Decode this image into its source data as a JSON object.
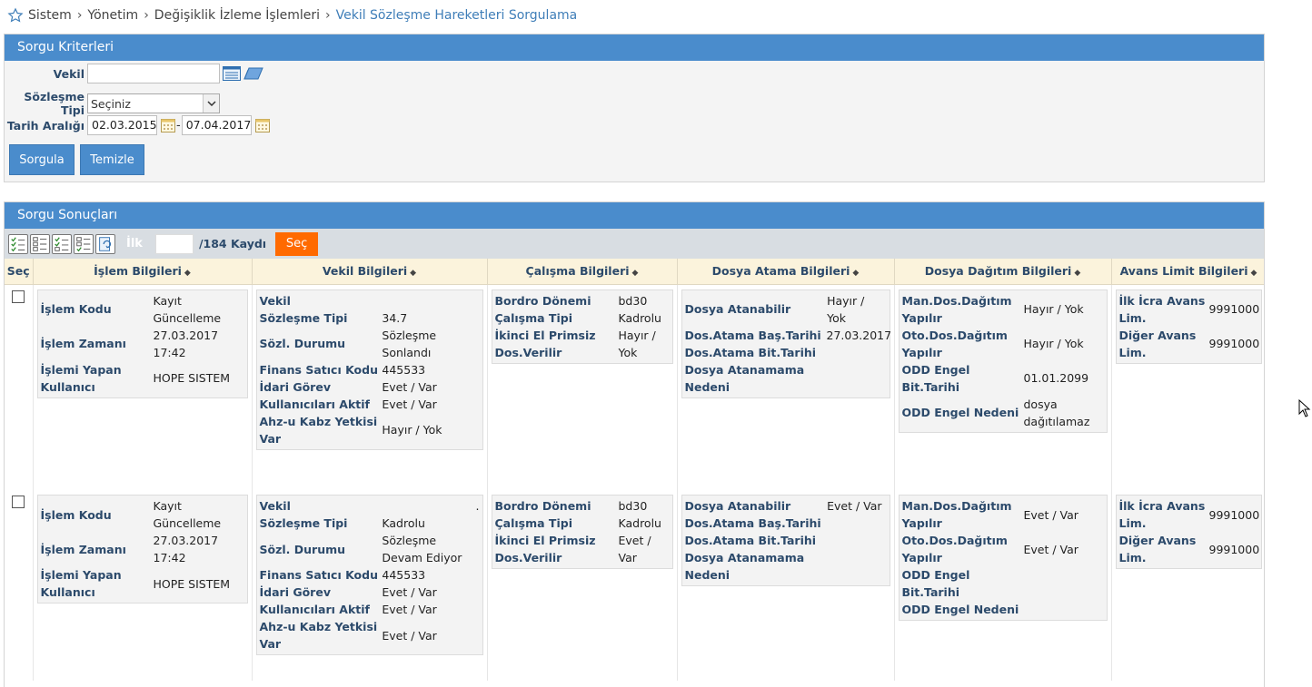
{
  "breadcrumb": [
    "Sistem",
    "Yönetim",
    "Değişiklik İzleme İşlemleri",
    "Vekil Sözleşme Hareketleri Sorgulama"
  ],
  "criteria": {
    "title": "Sorgu Kriterleri",
    "vekil_label": "Vekil",
    "vekil_value": "",
    "sozlesme_label": "Sözleşme Tipi",
    "sozlesme_value": "Seçiniz",
    "tarih_label": "Tarih Aralığı",
    "tarih_start": "02.03.2015",
    "tarih_dash": "-",
    "tarih_end": "07.04.2017",
    "sorgula": "Sorgula",
    "temizle": "Temizle"
  },
  "results": {
    "title": "Sorgu Sonuçları",
    "ilk_label": "İlk",
    "ilk_value": "",
    "count_label": "/184 Kaydı",
    "sec_button": "Seç",
    "headers": [
      "Seç",
      "İşlem Bilgileri",
      "Vekil Bilgileri",
      "Çalışma Bilgileri",
      "Dosya Atama Bilgileri",
      "Dosya Dağıtım Bilgileri",
      "Avans Limit Bilgileri"
    ],
    "rows": [
      {
        "islem": [
          {
            "k": "İşlem Kodu",
            "v": "Kayıt Güncelleme"
          },
          {
            "k": "İşlem Zamanı",
            "v": "27.03.2017 17:42"
          },
          {
            "k": "İşlemi Yapan Kullanıcı",
            "v": "HOPE SISTEM"
          }
        ],
        "vekil": [
          {
            "k": "Vekil",
            "v": ""
          },
          {
            "k": "Sözleşme Tipi",
            "v": "34.7"
          },
          {
            "k": "Sözl. Durumu",
            "v": "Sözleşme Sonlandı"
          },
          {
            "k": "Finans Satıcı Kodu",
            "v": "445533"
          },
          {
            "k": "İdari Görev",
            "v": "Evet / Var"
          },
          {
            "k": "Kullanıcıları Aktif",
            "v": "Evet / Var"
          },
          {
            "k": "Ahz-u Kabz Yetkisi Var",
            "v": "Hayır / Yok"
          }
        ],
        "calisma": [
          {
            "k": "Bordro Dönemi",
            "v": "bd30"
          },
          {
            "k": "Çalışma Tipi",
            "v": "Kadrolu"
          },
          {
            "k": "İkinci El Primsiz Dos.Verilir",
            "v": "Hayır / Yok"
          }
        ],
        "atama": [
          {
            "k": "Dosya Atanabilir",
            "v": "Hayır / Yok"
          },
          {
            "k": "Dos.Atama Baş.Tarihi",
            "v": "27.03.2017"
          },
          {
            "k": "Dos.Atama Bit.Tarihi",
            "v": ""
          },
          {
            "k": "Dosya Atanamama Nedeni",
            "v": ""
          }
        ],
        "dagitim": [
          {
            "k": "Man.Dos.Dağıtım Yapılır",
            "v": "Hayır / Yok"
          },
          {
            "k": "Oto.Dos.Dağıtım Yapılır",
            "v": "Hayır / Yok"
          },
          {
            "k": "ODD Engel Bit.Tarihi",
            "v": "01.01.2099"
          },
          {
            "k": "ODD Engel Nedeni",
            "v": "dosya dağıtılamaz"
          }
        ],
        "avans": [
          {
            "k": "İlk İcra Avans Lim.",
            "v": "9991000"
          },
          {
            "k": "Diğer Avans Lim.",
            "v": "9991000"
          }
        ]
      },
      {
        "islem": [
          {
            "k": "İşlem Kodu",
            "v": "Kayıt Güncelleme"
          },
          {
            "k": "İşlem Zamanı",
            "v": "27.03.2017 17:42"
          },
          {
            "k": "İşlemi Yapan Kullanıcı",
            "v": "HOPE SISTEM"
          }
        ],
        "vekil": [
          {
            "k": "Vekil",
            "v": "."
          },
          {
            "k": "Sözleşme Tipi",
            "v": "Kadrolu"
          },
          {
            "k": "Sözl. Durumu",
            "v": "Sözleşme Devam Ediyor"
          },
          {
            "k": "Finans Satıcı Kodu",
            "v": "445533"
          },
          {
            "k": "İdari Görev",
            "v": "Evet / Var"
          },
          {
            "k": "Kullanıcıları Aktif",
            "v": "Evet / Var"
          },
          {
            "k": "Ahz-u Kabz Yetkisi Var",
            "v": "Evet / Var"
          }
        ],
        "calisma": [
          {
            "k": "Bordro Dönemi",
            "v": "bd30"
          },
          {
            "k": "Çalışma Tipi",
            "v": "Kadrolu"
          },
          {
            "k": "İkinci El Primsiz Dos.Verilir",
            "v": "Evet / Var"
          }
        ],
        "atama": [
          {
            "k": "Dosya Atanabilir",
            "v": "Evet / Var"
          },
          {
            "k": "Dos.Atama Baş.Tarihi",
            "v": ""
          },
          {
            "k": "Dos.Atama Bit.Tarihi",
            "v": ""
          },
          {
            "k": "Dosya Atanamama Nedeni",
            "v": ""
          }
        ],
        "dagitim": [
          {
            "k": "Man.Dos.Dağıtım Yapılır",
            "v": "Evet / Var"
          },
          {
            "k": "Oto.Dos.Dağıtım Yapılır",
            "v": "Evet / Var"
          },
          {
            "k": "ODD Engel Bit.Tarihi",
            "v": ""
          },
          {
            "k": "ODD Engel Nedeni",
            "v": ""
          }
        ],
        "avans": [
          {
            "k": "İlk İcra Avans Lim.",
            "v": "9991000"
          },
          {
            "k": "Diğer Avans Lim.",
            "v": "9991000"
          }
        ]
      }
    ]
  },
  "colors": {
    "header_blue": "#4a8ccc",
    "label_navy": "#2c4a6b",
    "accent_orange": "#ff6a00",
    "th_bg": "#fbf3dc"
  }
}
